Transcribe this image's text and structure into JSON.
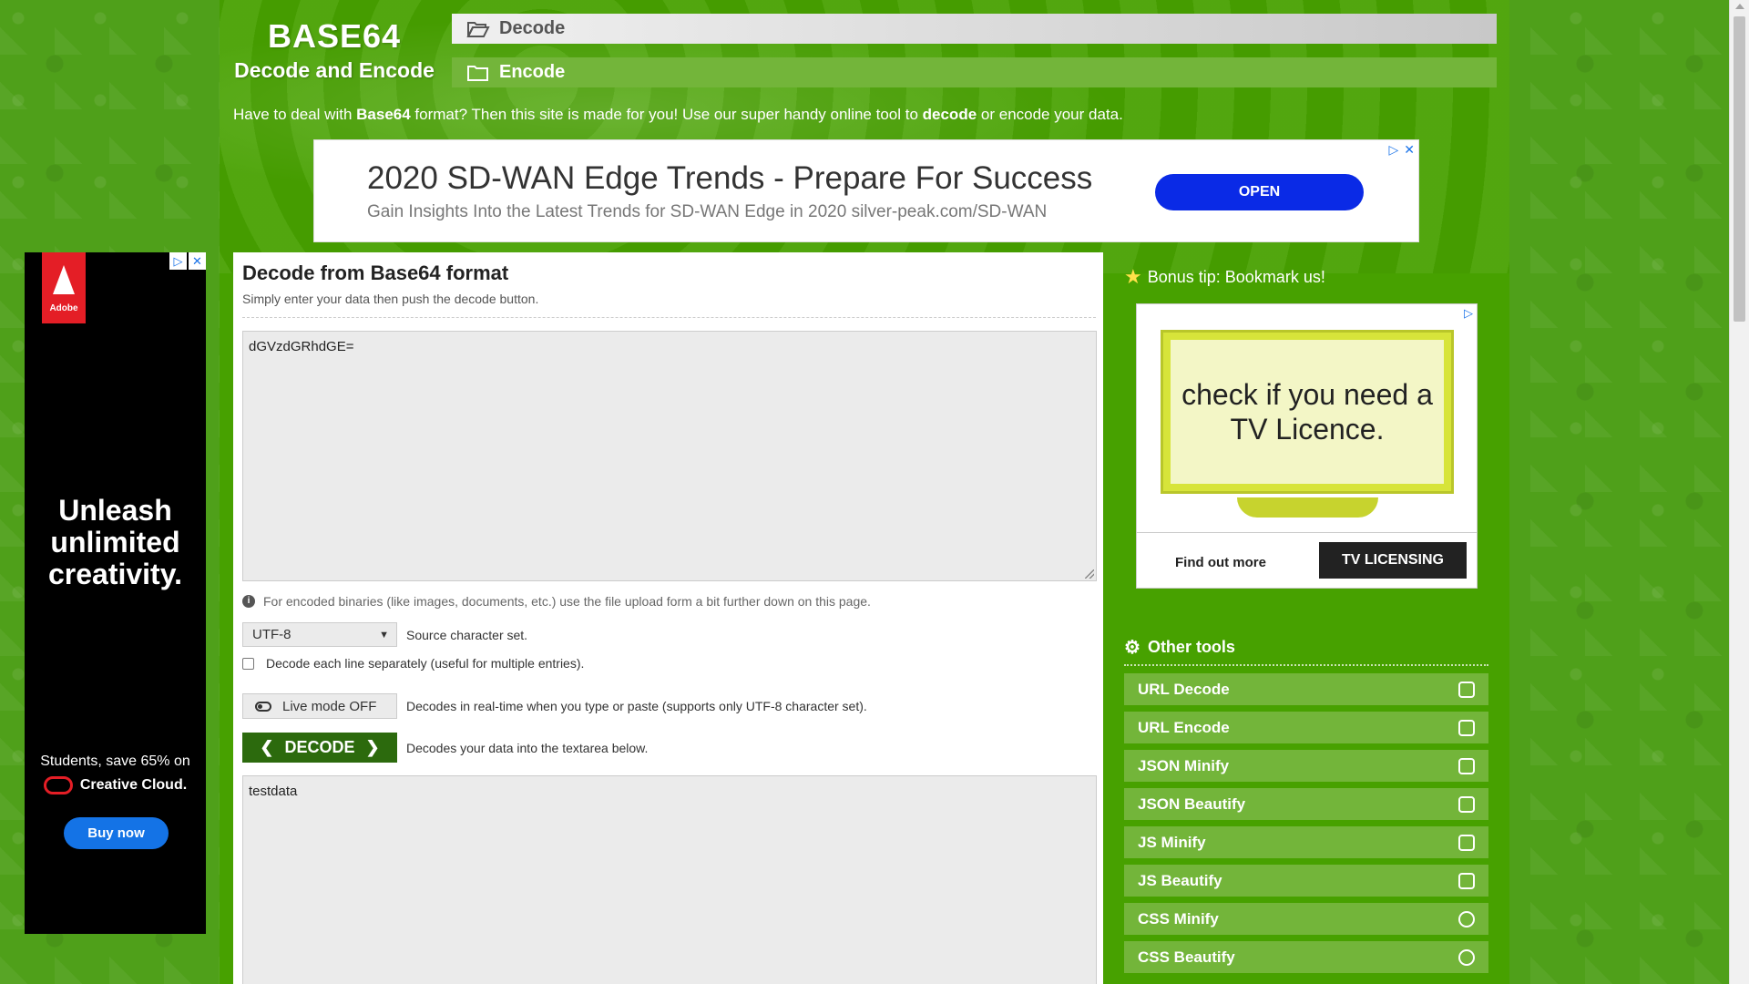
{
  "header": {
    "logo_title": "BASE64",
    "logo_subtitle": "Decode and Encode",
    "nav_decode": "Decode",
    "nav_encode": "Encode"
  },
  "intro": {
    "part1": "Have to deal with ",
    "bold1": "Base64",
    "part2": " format? Then this site is made for you! Use our super handy online tool to ",
    "bold2": "decode",
    "part3": " or encode your data."
  },
  "ad_top": {
    "headline": "2020 SD-WAN Edge Trends - Prepare For Success",
    "sub": "Gain Insights Into the Latest Trends for SD-WAN Edge in 2020 silver-peak.com/SD-WAN",
    "button": "OPEN"
  },
  "ad_left": {
    "brand": "Adobe",
    "tagline": "Unleash unlimited creativity.",
    "students": "Students, save 65% on",
    "product": "Creative Cloud.",
    "button": "Buy now"
  },
  "form": {
    "title": "Decode from Base64 format",
    "lead": "Simply enter your data then push the decode button.",
    "source_value": "dGVzdGRhdGE=",
    "note": "For encoded binaries (like images, documents, etc.) use the file upload form a bit further down on this page.",
    "charset_value": "UTF-8",
    "charset_label": "Source character set.",
    "each_line_label": "Decode each line separately (useful for multiple entries).",
    "live_mode_label": "Live mode OFF",
    "live_mode_desc": "Decodes in real-time when you type or paste (supports only UTF-8 character set).",
    "decode_label": "DECODE",
    "decode_desc": "Decodes your data into the textarea below.",
    "result_value": "testdata"
  },
  "sidebar": {
    "bonus": "Bonus tip: Bookmark us!",
    "ad_text": "check if you need a TV Licence.",
    "ad_find": "Find out more",
    "ad_brand": "TV LICENSING",
    "other_tools_title": "Other tools",
    "tools": [
      {
        "label": "URL Decode",
        "icon": "envelope-open-icon"
      },
      {
        "label": "URL Encode",
        "icon": "envelope-icon"
      },
      {
        "label": "JSON Minify",
        "icon": "file-icon"
      },
      {
        "label": "JSON Beautify",
        "icon": "file-image-icon"
      },
      {
        "label": "JS Minify",
        "icon": "hand-icon"
      },
      {
        "label": "JS Beautify",
        "icon": "hand-paper-icon"
      },
      {
        "label": "CSS Minify",
        "icon": "meh-icon"
      },
      {
        "label": "CSS Beautify",
        "icon": "smile-icon"
      }
    ]
  },
  "colors": {
    "page_bg": "#4fa01a",
    "accent": "#73b53a",
    "decode_button": "#2c6a0d",
    "ad_button": "#0a2ae6"
  }
}
